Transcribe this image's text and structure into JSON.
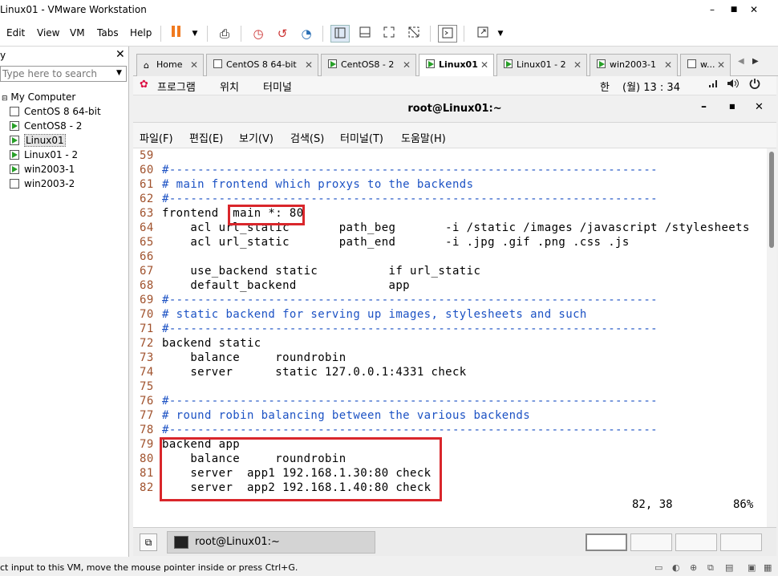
{
  "window": {
    "title": "Linux01 - VMware Workstation"
  },
  "menus": [
    "Edit",
    "View",
    "VM",
    "Tabs",
    "Help"
  ],
  "library": {
    "header": "y",
    "search_placeholder": "Type here to search",
    "root": "My Computer",
    "items": [
      {
        "label": "CentOS 8 64-bit",
        "running": false
      },
      {
        "label": "CentOS8 - 2",
        "running": true
      },
      {
        "label": "Linux01",
        "running": true,
        "selected": true
      },
      {
        "label": "Linux01 - 2",
        "running": true
      },
      {
        "label": "win2003-1",
        "running": true
      },
      {
        "label": "win2003-2",
        "running": false
      }
    ]
  },
  "tabs": [
    {
      "label": "Home",
      "active": false
    },
    {
      "label": "CentOS 8 64-bit",
      "active": false
    },
    {
      "label": "CentOS8 - 2",
      "active": false
    },
    {
      "label": "Linux01",
      "active": true
    },
    {
      "label": "Linux01 - 2",
      "active": false
    },
    {
      "label": "win2003-1",
      "active": false
    },
    {
      "label": "w...",
      "active": false
    }
  ],
  "gnome": {
    "programs": "프로그램",
    "places": "위치",
    "terminal": "터미널",
    "input_method": "한",
    "clock": "(월) 13 : 34"
  },
  "terminal": {
    "title": "root@Linux01:~",
    "menu": [
      "파일(F)",
      "편집(E)",
      "보기(V)",
      "검색(S)",
      "터미널(T)",
      "도움말(H)"
    ],
    "lines": [
      {
        "no": "59",
        "text": ""
      },
      {
        "no": "60",
        "text": "#---------------------------------------------------------------------",
        "comment": true
      },
      {
        "no": "61",
        "text": "# main frontend which proxys to the backends",
        "comment": true
      },
      {
        "no": "62",
        "text": "#---------------------------------------------------------------------",
        "comment": true
      },
      {
        "no": "63",
        "text": "frontend  main *: 80"
      },
      {
        "no": "64",
        "text": "    acl url_static       path_beg       -i /static /images /javascript /stylesheets"
      },
      {
        "no": "65",
        "text": "    acl url_static       path_end       -i .jpg .gif .png .css .js"
      },
      {
        "no": "66",
        "text": ""
      },
      {
        "no": "67",
        "text": "    use_backend static          if url_static"
      },
      {
        "no": "68",
        "text": "    default_backend             app"
      },
      {
        "no": "69",
        "text": "#---------------------------------------------------------------------",
        "comment": true
      },
      {
        "no": "70",
        "text": "# static backend for serving up images, stylesheets and such",
        "comment": true
      },
      {
        "no": "71",
        "text": "#---------------------------------------------------------------------",
        "comment": true
      },
      {
        "no": "72",
        "text": "backend static"
      },
      {
        "no": "73",
        "text": "    balance     roundrobin"
      },
      {
        "no": "74",
        "text": "    server      static 127.0.0.1:4331 check"
      },
      {
        "no": "75",
        "text": ""
      },
      {
        "no": "76",
        "text": "#---------------------------------------------------------------------",
        "comment": true
      },
      {
        "no": "77",
        "text": "# round robin balancing between the various backends",
        "comment": true
      },
      {
        "no": "78",
        "text": "#---------------------------------------------------------------------",
        "comment": true
      },
      {
        "no": "79",
        "text": "backend app"
      },
      {
        "no": "80",
        "text": "    balance     roundrobin"
      },
      {
        "no": "81",
        "text": "    server  app1 192.168.1.30:80 check"
      },
      {
        "no": "82",
        "text": "    server  app2 192.168.1.40:80 check"
      }
    ],
    "cursor_pos": "82, 38",
    "scroll_pct": "86%"
  },
  "taskbar": {
    "terminal_item": "root@Linux01:~"
  },
  "statusbar": {
    "text": "ct input to this VM, move the mouse pointer inside or press Ctrl+G."
  },
  "colors": {
    "highlight_box": "#d9262b",
    "comment": "#1c52c4",
    "line_number": "#a0522d"
  }
}
